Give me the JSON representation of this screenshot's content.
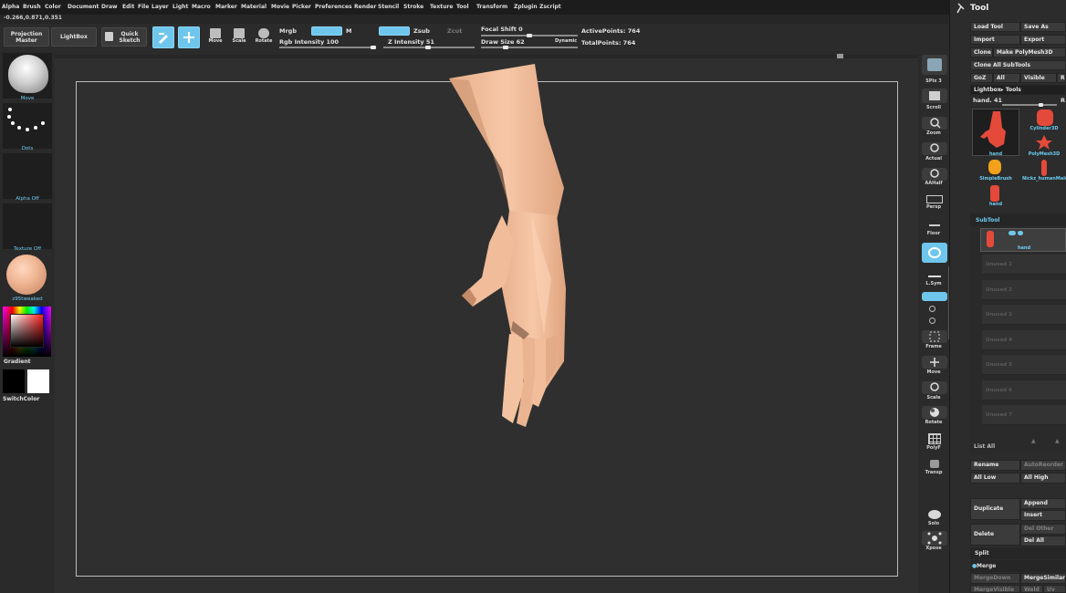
{
  "menu": [
    "Alpha",
    "Brush",
    "Color",
    "Document",
    "Draw",
    "Edit",
    "File",
    "Layer",
    "Light",
    "Macro",
    "Marker",
    "Material",
    "Movie",
    "Picker",
    "Preferences",
    "Render",
    "Stencil",
    "Stroke",
    "Texture",
    "Tool",
    "Transform",
    "Zplugin",
    "Zscript"
  ],
  "coords": "-0.266,0.871,0.351",
  "shelf": {
    "projection_master": "Projection Master",
    "lightbox": "LightBox",
    "quick_sketch": "Quick Sketch",
    "move": "Move",
    "scale": "Scale",
    "rotate": "Rotate",
    "mrgb": "Mrgb",
    "rgb": "Rgb",
    "m": "M",
    "rgb_intensity": "Rgb Intensity 100",
    "zadd": "Zadd",
    "zsub": "Zsub",
    "zcut": "Zcut",
    "z_intensity": "Z Intensity 51",
    "focal_shift": "Focal Shift 0",
    "draw_size": "Draw Size 62",
    "dynamic": "Dynamic",
    "active_points": "ActivePoints: 764",
    "total_points": "TotalPoints: 764"
  },
  "lefttray": {
    "brush": "Move",
    "stroke": "Dots",
    "alpha": "Alpha Off",
    "texture": "Texture Off",
    "material": "z95tweaked",
    "gradient": "Gradient",
    "switch_color": "SwitchColor"
  },
  "rightdock": [
    "SPix 3",
    "Scroll",
    "Zoom",
    "Actual",
    "AAHalf",
    "Persp",
    "Floor",
    "",
    "L.Sym",
    "",
    "",
    "Frame",
    "Move",
    "Scale",
    "Rotate",
    "PolyF",
    "Transp",
    "Solo",
    "Xpose"
  ],
  "tool": {
    "title": "Tool",
    "load_tool": "Load Tool",
    "save_as": "Save As",
    "import": "Import",
    "export": "Export",
    "clone": "Clone",
    "make_polymesh": "Make PolyMesh3D",
    "clone_all": "Clone All SubTools",
    "goz": "GoZ",
    "all": "All",
    "visible": "Visible",
    "r": "R",
    "lightbox_tools": "Lightbox▸ Tools",
    "current_tool": "hand. 41",
    "r2": "R",
    "tools": [
      {
        "name": "hand"
      },
      {
        "name": "Cylinder3D"
      },
      {
        "name": "PolyMesh3D"
      },
      {
        "name": "SimpleBrush"
      },
      {
        "name": "Nickz_humanMale"
      },
      {
        "name": "hand"
      }
    ],
    "subtool_header": "SubTool",
    "subtool_active": "hand",
    "unused": [
      "Unused 1",
      "Unused 2",
      "Unused 3",
      "Unused 4",
      "Unused 5",
      "Unused 6",
      "Unused 7"
    ],
    "list_all": "List All",
    "rename": "Rename",
    "auto_reorder": "AutoReorder",
    "all_low": "All Low",
    "all_high": "All High",
    "duplicate": "Duplicate",
    "append": "Append",
    "insert": "Insert",
    "delete": "Delete",
    "del_other": "Del Other",
    "del_all": "Del All",
    "split": "Split",
    "merge": "Merge",
    "merge_down": "MergeDown",
    "merge_similar": "MergeSimilar",
    "merge_visible": "MergeVisible",
    "weld": "Weld",
    "uv": "Uv"
  },
  "colors": {
    "accent": "#6fc6ec",
    "skin": "#f2c0a0",
    "background": "#2f2f2f"
  }
}
